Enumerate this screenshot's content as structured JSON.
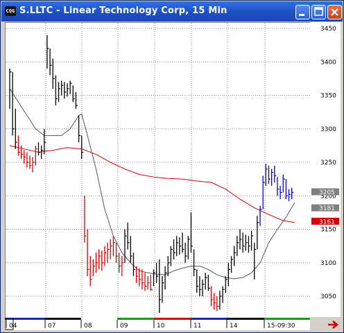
{
  "window": {
    "icon_label": "CQG",
    "title": "S.LLTC - Linear Technology Corp, 15 Min"
  },
  "colors": {
    "up_bar": "#000000",
    "red_bar": "#d40000",
    "blue_bar": "#0000d4",
    "ma_fast": "#555555",
    "ma_slow": "#d40000",
    "grid": "#888888"
  },
  "chart_data": {
    "type": "ohlc",
    "title": "S.LLTC - Linear Technology Corp, 15 Min",
    "y_ticks": [
      3450,
      3400,
      3350,
      3300,
      3250,
      3200,
      3150,
      3100,
      3050
    ],
    "ylim": [
      3020,
      3460
    ],
    "x_ticks": [
      "04",
      "07",
      "08",
      "09",
      "10",
      "11",
      "14",
      "15-09:30"
    ],
    "price_labels": [
      {
        "value": "3205",
        "color": "#808080"
      },
      {
        "value": "3181",
        "color": "#808080"
      },
      {
        "value": "3161",
        "color": "#d40000"
      }
    ],
    "bars": [
      {
        "h": 3390,
        "l": 3330,
        "c": 3385,
        "col": "k"
      },
      {
        "h": 3385,
        "l": 3290,
        "c": 3300,
        "col": "k"
      },
      {
        "h": 3330,
        "l": 3270,
        "c": 3280,
        "col": "k"
      },
      {
        "h": 3290,
        "l": 3260,
        "c": 3265,
        "col": "r"
      },
      {
        "h": 3275,
        "l": 3255,
        "c": 3262,
        "col": "r"
      },
      {
        "h": 3268,
        "l": 3248,
        "c": 3258,
        "col": "r"
      },
      {
        "h": 3265,
        "l": 3242,
        "c": 3250,
        "col": "r"
      },
      {
        "h": 3260,
        "l": 3240,
        "c": 3245,
        "col": "r"
      },
      {
        "h": 3258,
        "l": 3235,
        "c": 3250,
        "col": "r"
      },
      {
        "h": 3275,
        "l": 3245,
        "c": 3270,
        "col": "r"
      },
      {
        "h": 3280,
        "l": 3260,
        "c": 3265,
        "col": "k"
      },
      {
        "h": 3275,
        "l": 3255,
        "c": 3268,
        "col": "k"
      },
      {
        "h": 3300,
        "l": 3262,
        "c": 3280,
        "col": "k"
      },
      {
        "h": 3440,
        "l": 3390,
        "c": 3420,
        "col": "k"
      },
      {
        "h": 3420,
        "l": 3380,
        "c": 3395,
        "col": "k"
      },
      {
        "h": 3405,
        "l": 3360,
        "c": 3375,
        "col": "k"
      },
      {
        "h": 3380,
        "l": 3335,
        "c": 3345,
        "col": "k"
      },
      {
        "h": 3370,
        "l": 3340,
        "c": 3360,
        "col": "k"
      },
      {
        "h": 3372,
        "l": 3350,
        "c": 3365,
        "col": "k"
      },
      {
        "h": 3370,
        "l": 3345,
        "c": 3355,
        "col": "k"
      },
      {
        "h": 3368,
        "l": 3348,
        "c": 3360,
        "col": "k"
      },
      {
        "h": 3372,
        "l": 3352,
        "c": 3368,
        "col": "k"
      },
      {
        "h": 3365,
        "l": 3340,
        "c": 3345,
        "col": "k"
      },
      {
        "h": 3355,
        "l": 3330,
        "c": 3335,
        "col": "k"
      },
      {
        "h": 3320,
        "l": 3280,
        "c": 3290,
        "col": "k"
      },
      {
        "h": 3290,
        "l": 3255,
        "c": 3265,
        "col": "k"
      },
      {
        "h": 3200,
        "l": 3130,
        "c": 3140,
        "col": "r"
      },
      {
        "h": 3150,
        "l": 3080,
        "c": 3090,
        "col": "r"
      },
      {
        "h": 3110,
        "l": 3065,
        "c": 3075,
        "col": "r"
      },
      {
        "h": 3105,
        "l": 3080,
        "c": 3095,
        "col": "r"
      },
      {
        "h": 3115,
        "l": 3085,
        "c": 3100,
        "col": "r"
      },
      {
        "h": 3120,
        "l": 3090,
        "c": 3110,
        "col": "r"
      },
      {
        "h": 3118,
        "l": 3088,
        "c": 3100,
        "col": "r"
      },
      {
        "h": 3125,
        "l": 3095,
        "c": 3115,
        "col": "r"
      },
      {
        "h": 3130,
        "l": 3100,
        "c": 3120,
        "col": "r"
      },
      {
        "h": 3135,
        "l": 3105,
        "c": 3125,
        "col": "r"
      },
      {
        "h": 3140,
        "l": 3110,
        "c": 3130,
        "col": "r"
      },
      {
        "h": 3130,
        "l": 3100,
        "c": 3110,
        "col": "r"
      },
      {
        "h": 3115,
        "l": 3085,
        "c": 3095,
        "col": "r"
      },
      {
        "h": 3110,
        "l": 3080,
        "c": 3100,
        "col": "r"
      },
      {
        "h": 3150,
        "l": 3100,
        "c": 3140,
        "col": "k"
      },
      {
        "h": 3160,
        "l": 3120,
        "c": 3130,
        "col": "k"
      },
      {
        "h": 3140,
        "l": 3100,
        "c": 3110,
        "col": "k"
      },
      {
        "h": 3115,
        "l": 3080,
        "c": 3090,
        "col": "k"
      },
      {
        "h": 3095,
        "l": 3070,
        "c": 3080,
        "col": "r"
      },
      {
        "h": 3092,
        "l": 3065,
        "c": 3075,
        "col": "r"
      },
      {
        "h": 3090,
        "l": 3060,
        "c": 3070,
        "col": "r"
      },
      {
        "h": 3085,
        "l": 3058,
        "c": 3065,
        "col": "r"
      },
      {
        "h": 3080,
        "l": 3060,
        "c": 3070,
        "col": "r"
      },
      {
        "h": 3082,
        "l": 3058,
        "c": 3060,
        "col": "r"
      },
      {
        "h": 3090,
        "l": 3065,
        "c": 3085,
        "col": "k"
      },
      {
        "h": 3100,
        "l": 3070,
        "c": 3080,
        "col": "k"
      },
      {
        "h": 3105,
        "l": 3025,
        "c": 3045,
        "col": "k"
      },
      {
        "h": 3080,
        "l": 3040,
        "c": 3070,
        "col": "k"
      },
      {
        "h": 3095,
        "l": 3060,
        "c": 3085,
        "col": "k"
      },
      {
        "h": 3110,
        "l": 3080,
        "c": 3100,
        "col": "k"
      },
      {
        "h": 3125,
        "l": 3095,
        "c": 3120,
        "col": "k"
      },
      {
        "h": 3135,
        "l": 3105,
        "c": 3115,
        "col": "k"
      },
      {
        "h": 3140,
        "l": 3110,
        "c": 3130,
        "col": "k"
      },
      {
        "h": 3138,
        "l": 3112,
        "c": 3125,
        "col": "k"
      },
      {
        "h": 3145,
        "l": 3115,
        "c": 3120,
        "col": "k"
      },
      {
        "h": 3130,
        "l": 3100,
        "c": 3110,
        "col": "k"
      },
      {
        "h": 3140,
        "l": 3105,
        "c": 3135,
        "col": "k"
      },
      {
        "h": 3175,
        "l": 3115,
        "c": 3125,
        "col": "k"
      },
      {
        "h": 3120,
        "l": 3080,
        "c": 3090,
        "col": "k"
      },
      {
        "h": 3090,
        "l": 3055,
        "c": 3065,
        "col": "k"
      },
      {
        "h": 3080,
        "l": 3050,
        "c": 3060,
        "col": "k"
      },
      {
        "h": 3075,
        "l": 3050,
        "c": 3068,
        "col": "k"
      },
      {
        "h": 3085,
        "l": 3060,
        "c": 3078,
        "col": "k"
      },
      {
        "h": 3082,
        "l": 3058,
        "c": 3062,
        "col": "k"
      },
      {
        "h": 3065,
        "l": 3035,
        "c": 3045,
        "col": "r"
      },
      {
        "h": 3055,
        "l": 3030,
        "c": 3040,
        "col": "r"
      },
      {
        "h": 3050,
        "l": 3028,
        "c": 3035,
        "col": "r"
      },
      {
        "h": 3058,
        "l": 3030,
        "c": 3050,
        "col": "k"
      },
      {
        "h": 3065,
        "l": 3040,
        "c": 3060,
        "col": "k"
      },
      {
        "h": 3080,
        "l": 3055,
        "c": 3075,
        "col": "k"
      },
      {
        "h": 3100,
        "l": 3065,
        "c": 3090,
        "col": "k"
      },
      {
        "h": 3110,
        "l": 3085,
        "c": 3105,
        "col": "k"
      },
      {
        "h": 3125,
        "l": 3095,
        "c": 3115,
        "col": "k"
      },
      {
        "h": 3140,
        "l": 3110,
        "c": 3130,
        "col": "k"
      },
      {
        "h": 3150,
        "l": 3120,
        "c": 3135,
        "col": "k"
      },
      {
        "h": 3145,
        "l": 3115,
        "c": 3125,
        "col": "k"
      },
      {
        "h": 3142,
        "l": 3118,
        "c": 3130,
        "col": "k"
      },
      {
        "h": 3140,
        "l": 3115,
        "c": 3125,
        "col": "k"
      },
      {
        "h": 3148,
        "l": 3118,
        "c": 3140,
        "col": "k"
      },
      {
        "h": 3130,
        "l": 3075,
        "c": 3120,
        "col": "k"
      },
      {
        "h": 3170,
        "l": 3120,
        "c": 3160,
        "col": "k"
      },
      {
        "h": 3185,
        "l": 3155,
        "c": 3180,
        "col": "b"
      },
      {
        "h": 3230,
        "l": 3180,
        "c": 3220,
        "col": "b"
      },
      {
        "h": 3248,
        "l": 3215,
        "c": 3240,
        "col": "b"
      },
      {
        "h": 3245,
        "l": 3218,
        "c": 3225,
        "col": "b"
      },
      {
        "h": 3240,
        "l": 3215,
        "c": 3235,
        "col": "b"
      },
      {
        "h": 3245,
        "l": 3220,
        "c": 3230,
        "col": "b"
      },
      {
        "h": 3228,
        "l": 3200,
        "c": 3210,
        "col": "b"
      },
      {
        "h": 3215,
        "l": 3195,
        "c": 3205,
        "col": "b"
      },
      {
        "h": 3232,
        "l": 3205,
        "c": 3225,
        "col": "b"
      },
      {
        "h": 3225,
        "l": 3195,
        "c": 3200,
        "col": "b"
      },
      {
        "h": 3210,
        "l": 3192,
        "c": 3202,
        "col": "b"
      },
      {
        "h": 3212,
        "l": 3195,
        "c": 3205,
        "col": "b"
      }
    ],
    "ma_fast": [
      [
        0,
        3360
      ],
      [
        3,
        3340
      ],
      [
        6,
        3320
      ],
      [
        9,
        3300
      ],
      [
        12,
        3290
      ],
      [
        15,
        3290
      ],
      [
        18,
        3290
      ],
      [
        21,
        3300
      ],
      [
        24,
        3320
      ],
      [
        25,
        3322
      ],
      [
        27,
        3290
      ],
      [
        30,
        3240
      ],
      [
        33,
        3180
      ],
      [
        36,
        3140
      ],
      [
        39,
        3115
      ],
      [
        42,
        3100
      ],
      [
        45,
        3088
      ],
      [
        48,
        3085
      ],
      [
        51,
        3083
      ],
      [
        54,
        3082
      ],
      [
        57,
        3088
      ],
      [
        60,
        3092
      ],
      [
        63,
        3095
      ],
      [
        66,
        3095
      ],
      [
        69,
        3090
      ],
      [
        72,
        3082
      ],
      [
        75,
        3078
      ],
      [
        78,
        3076
      ],
      [
        81,
        3078
      ],
      [
        84,
        3085
      ],
      [
        87,
        3100
      ],
      [
        90,
        3130
      ],
      [
        93,
        3150
      ],
      [
        96,
        3168
      ],
      [
        99,
        3190
      ]
    ],
    "ma_slow": [
      [
        0,
        3275
      ],
      [
        5,
        3270
      ],
      [
        10,
        3265
      ],
      [
        15,
        3268
      ],
      [
        20,
        3272
      ],
      [
        25,
        3270
      ],
      [
        30,
        3262
      ],
      [
        35,
        3250
      ],
      [
        40,
        3240
      ],
      [
        45,
        3232
      ],
      [
        50,
        3228
      ],
      [
        55,
        3226
      ],
      [
        60,
        3225
      ],
      [
        65,
        3222
      ],
      [
        70,
        3220
      ],
      [
        75,
        3210
      ],
      [
        80,
        3195
      ],
      [
        85,
        3182
      ],
      [
        90,
        3172
      ],
      [
        95,
        3163
      ],
      [
        99,
        3160
      ]
    ]
  }
}
